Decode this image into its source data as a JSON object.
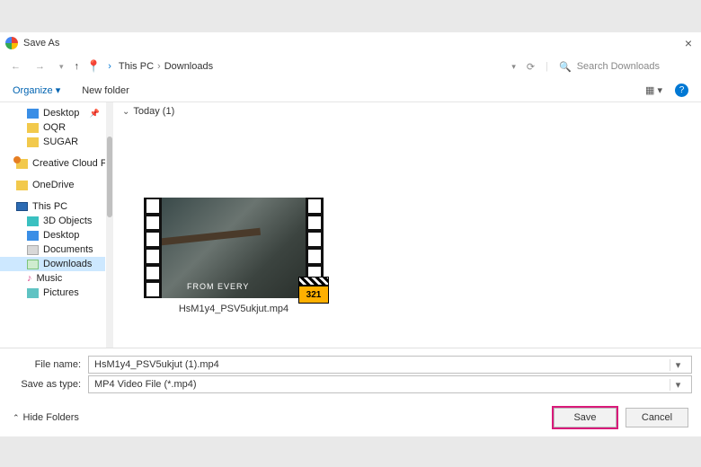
{
  "title": "Save As",
  "nav": {
    "location1": "This PC",
    "location2": "Downloads"
  },
  "search": {
    "placeholder": "Search Downloads"
  },
  "toolbar": {
    "organize": "Organize",
    "newfolder": "New folder"
  },
  "sidebar": {
    "desktop": "Desktop",
    "oqr": "OQR",
    "sugar": "SUGAR",
    "cc": "Creative Cloud Fi",
    "onedrive": "OneDrive",
    "thispc": "This PC",
    "objects3d": "3D Objects",
    "desktop2": "Desktop",
    "documents": "Documents",
    "downloads": "Downloads",
    "music": "Music",
    "pictures": "Pictures"
  },
  "content": {
    "group": "Today (1)",
    "frametext": "FROM EVERY",
    "mpc": "321",
    "thumbname": "HsM1y4_PSV5ukjut.mp4"
  },
  "fields": {
    "filename_label": "File name:",
    "filename_value": "HsM1y4_PSV5ukjut (1).mp4",
    "savetype_label": "Save as type:",
    "savetype_value": "MP4 Video File (*.mp4)"
  },
  "footer": {
    "hide": "Hide Folders",
    "save": "Save",
    "cancel": "Cancel"
  }
}
